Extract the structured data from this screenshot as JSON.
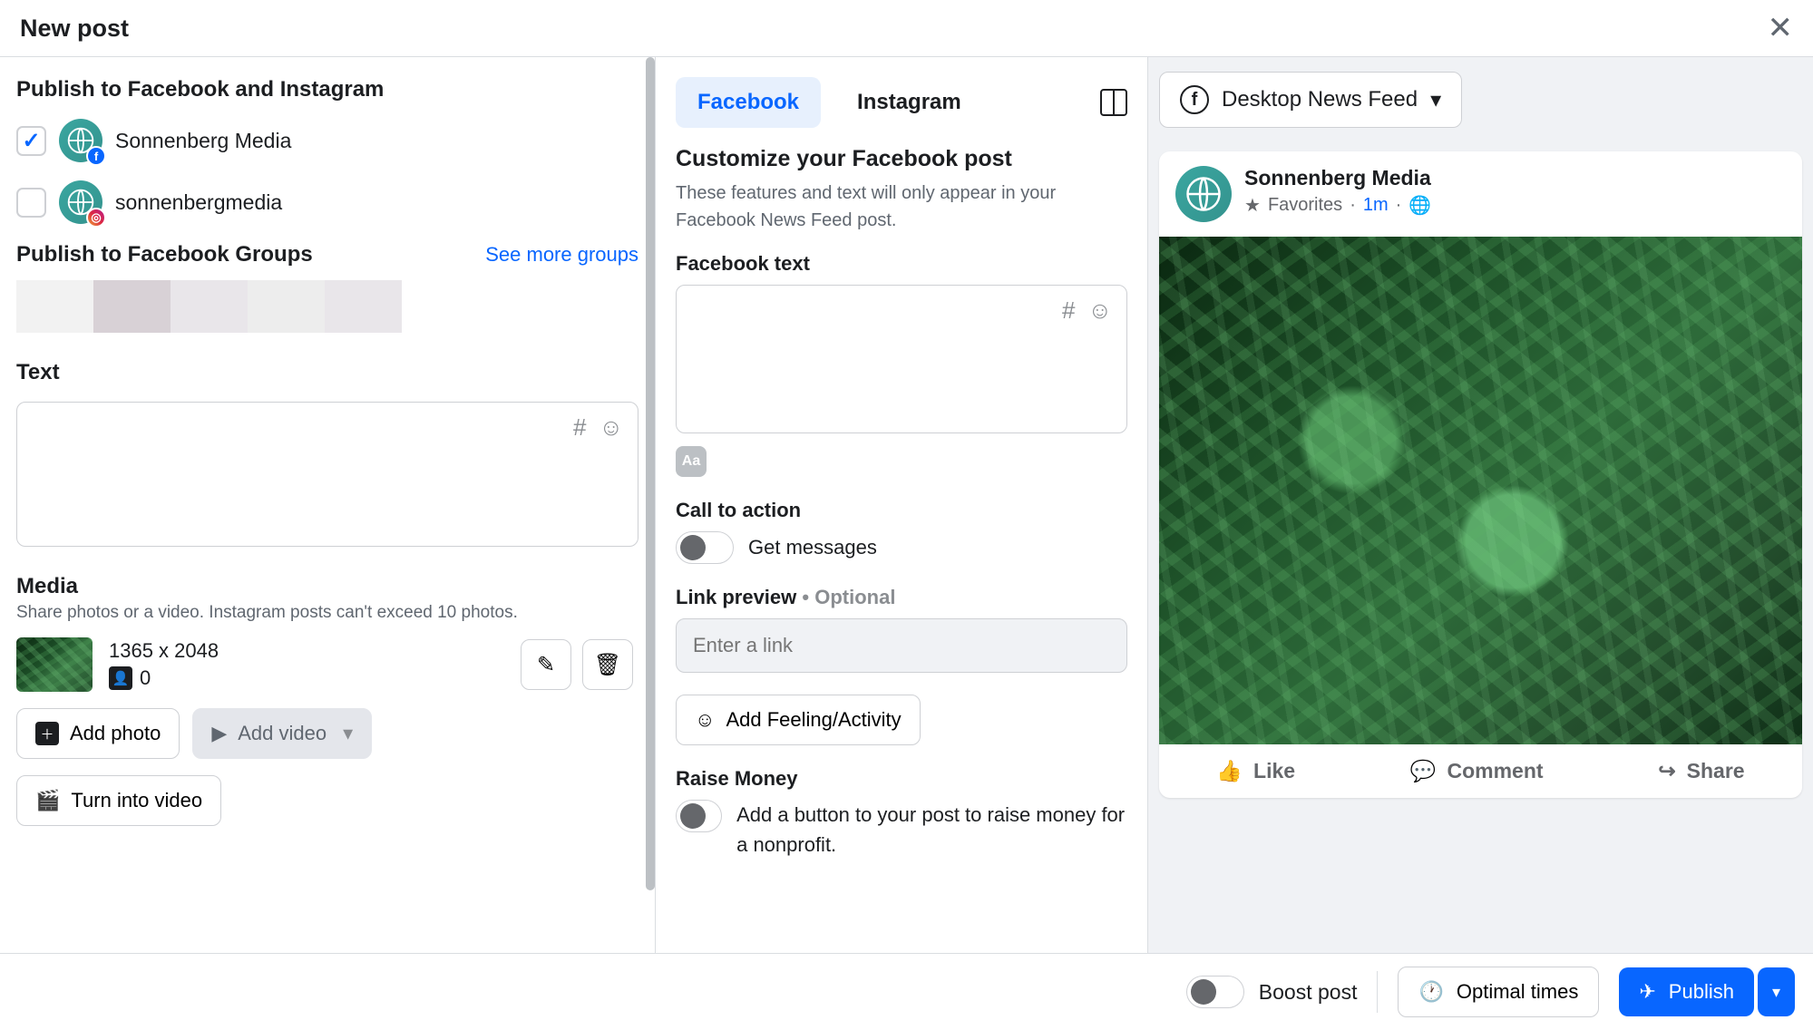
{
  "header": {
    "title": "New post"
  },
  "left": {
    "publish_heading": "Publish to Facebook and Instagram",
    "accounts": [
      {
        "name": "Sonnenberg Media",
        "platform": "facebook",
        "checked": true
      },
      {
        "name": "sonnenbergmedia",
        "platform": "instagram",
        "checked": false
      }
    ],
    "groups_heading": "Publish to Facebook Groups",
    "see_more": "See more groups",
    "text_heading": "Text",
    "media_heading": "Media",
    "media_sub": "Share photos or a video. Instagram posts can't exceed 10 photos.",
    "media_dimensions": "1365 x 2048",
    "media_tag_count": "0",
    "add_photo": "Add photo",
    "add_video": "Add video",
    "turn_into_video": "Turn into video"
  },
  "mid": {
    "tab_fb": "Facebook",
    "tab_ig": "Instagram",
    "customize_heading": "Customize your Facebook post",
    "customize_sub": "These features and text will only appear in your Facebook News Feed post.",
    "fb_text_label": "Facebook text",
    "aa_label": "Aa",
    "cta_heading": "Call to action",
    "cta_label": "Get messages",
    "link_preview_label": "Link preview",
    "optional": "Optional",
    "link_placeholder": "Enter a link",
    "feeling_label": "Add Feeling/Activity",
    "raise_heading": "Raise Money",
    "raise_sub": "Add a button to your post to raise money for a nonprofit."
  },
  "right": {
    "feed_selector": "Desktop News Feed",
    "preview_name": "Sonnenberg Media",
    "favorites": "Favorites",
    "time": "1m",
    "like": "Like",
    "comment": "Comment",
    "share": "Share"
  },
  "footer": {
    "boost": "Boost post",
    "optimal": "Optimal times",
    "publish": "Publish"
  }
}
